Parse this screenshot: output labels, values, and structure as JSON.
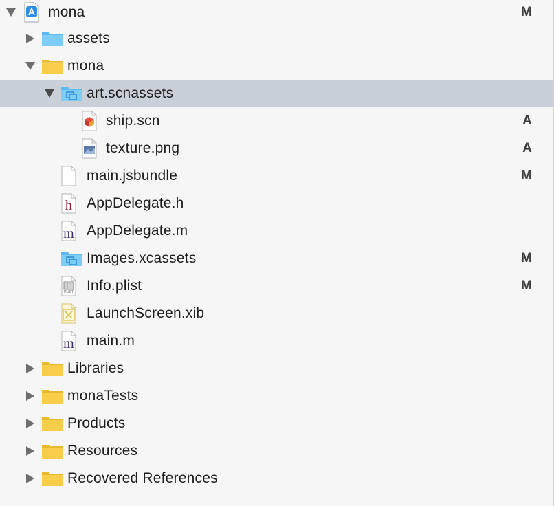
{
  "tree": {
    "project": {
      "label": "mona",
      "status": "M"
    },
    "assets": {
      "label": "assets"
    },
    "mona_group": {
      "label": "mona"
    },
    "art_scnassets": {
      "label": "art.scnassets"
    },
    "ship_scn": {
      "label": "ship.scn",
      "status": "A"
    },
    "texture_png": {
      "label": "texture.png",
      "status": "A"
    },
    "main_jsbundle": {
      "label": "main.jsbundle",
      "status": "M"
    },
    "appdelegate_h": {
      "label": "AppDelegate.h",
      "icon_letter": "h"
    },
    "appdelegate_m": {
      "label": "AppDelegate.m",
      "icon_letter": "m"
    },
    "images_xcassets": {
      "label": "Images.xcassets",
      "status": "M"
    },
    "info_plist": {
      "label": "Info.plist",
      "status": "M",
      "icon_text": "PLIST"
    },
    "launchscreen_xib": {
      "label": "LaunchScreen.xib"
    },
    "main_m": {
      "label": "main.m",
      "icon_letter": "m"
    },
    "libraries": {
      "label": "Libraries"
    },
    "monatests": {
      "label": "monaTests"
    },
    "products": {
      "label": "Products"
    },
    "resources": {
      "label": "Resources"
    },
    "recovered_references": {
      "label": "Recovered References"
    }
  },
  "colors": {
    "selection": "#c9d0d7",
    "folder_yellow": "#f6c944",
    "folder_blue": "#67c3f3",
    "h_letter": "#8b1b2d",
    "m_letter": "#3b2a6b"
  }
}
